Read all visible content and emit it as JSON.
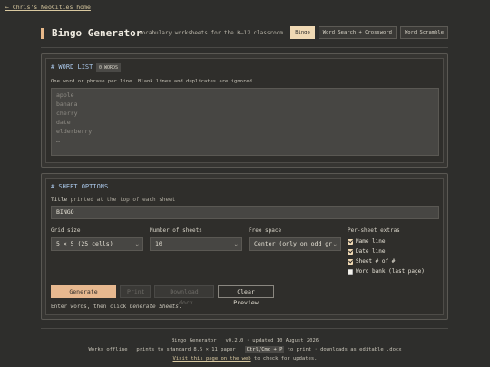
{
  "nav": {
    "back_link": "← Chris's NeoCities home"
  },
  "header": {
    "title": "Bingo Generator",
    "subtitle": "vocabulary worksheets for the K–12 classroom",
    "tabs": [
      {
        "label": "Bingo",
        "active": true
      },
      {
        "label": "Word Search + Crossword",
        "active": false
      },
      {
        "label": "Word Scramble",
        "active": false
      }
    ]
  },
  "word_list": {
    "title": "# WORD LIST",
    "count_badge": "0 WORDS",
    "hint": "One word or phrase per line.  Blank lines and duplicates are ignored.",
    "placeholder_lines": [
      "apple",
      "banana",
      "cherry",
      "date",
      "elderberry",
      "…"
    ]
  },
  "sheet_options": {
    "title": "# SHEET OPTIONS",
    "title_field": {
      "label": "Title",
      "label_hint": "printed at the top of each sheet",
      "value": "BINGO"
    },
    "grid_size": {
      "label": "Grid size",
      "value": "5 × 5 (25 cells)"
    },
    "num_sheets": {
      "label": "Number of sheets",
      "value": "10"
    },
    "free_space": {
      "label": "Free space",
      "value": "Center (only on odd gr"
    },
    "extras": {
      "label": "Per-sheet extras",
      "items": [
        {
          "label": "Name line",
          "checked": true
        },
        {
          "label": "Date line",
          "checked": true
        },
        {
          "label": "Sheet # of #",
          "checked": true
        },
        {
          "label": "Word bank (last page)",
          "checked": false
        }
      ]
    },
    "buttons": {
      "generate": "Generate Sheets",
      "print": "Print",
      "download": "Download .docx",
      "clear": "Clear Preview"
    },
    "status_prefix": "Enter words, then click ",
    "status_action": "Generate Sheets",
    "status_suffix": "."
  },
  "footer": {
    "line1": "Bingo Generator · v0.2.0 · updated 10 August 2026",
    "line2_a": "Works offline · prints to standard 8.5 × 11 paper · ",
    "line2_kbd": "Ctrl/Cmd + P",
    "line2_b": " to print · downloads as editable .docx",
    "line3_link": "Visit this page on the web",
    "line3_rest": " to check for updates."
  }
}
